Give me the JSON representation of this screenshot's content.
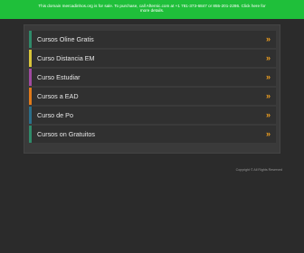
{
  "banner": {
    "line1": "This domain mercadinhos.org is for sale. To purchase, call Afternic.com at +1 781-373-6847 or 855-201-2286. Click here for",
    "line2": "more details.",
    "color": "#1fbf3a"
  },
  "links": [
    {
      "label": "Cursos Oline Gratis",
      "bar_color": "#2f8a6a",
      "arrow": "»"
    },
    {
      "label": "Curso Distancia EM",
      "bar_color": "#d8c53a",
      "arrow": "»"
    },
    {
      "label": "Curso Estudiar",
      "bar_color": "#a04aa0",
      "arrow": "»"
    },
    {
      "label": "Cursos a EAD",
      "bar_color": "#e07a1a",
      "arrow": "»"
    },
    {
      "label": "Curso de Po",
      "bar_color": "#2a6f8a",
      "arrow": "»"
    },
    {
      "label": "Cursos on Gratuitos",
      "bar_color": "#2f8a6a",
      "arrow": "»"
    }
  ],
  "footer": {
    "text": "Copyright © All Rights Reserved"
  },
  "colors": {
    "background": "#2b2b2b",
    "panel": "#3a3a3a",
    "arrow": "#f0a020"
  }
}
